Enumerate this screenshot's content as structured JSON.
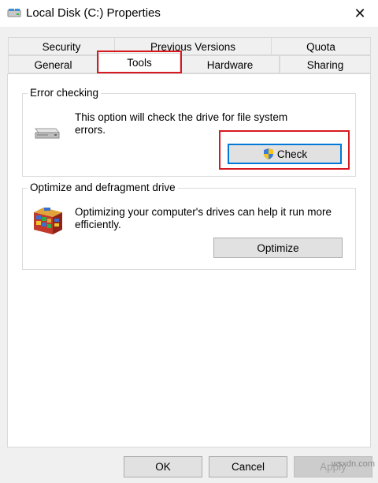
{
  "window": {
    "title": "Local Disk (C:) Properties",
    "close_glyph": "✕",
    "title_icon": "drive-icon"
  },
  "tabs": {
    "row_back": [
      {
        "label": "Security"
      },
      {
        "label": "Previous Versions"
      },
      {
        "label": "Quota"
      }
    ],
    "row_front": [
      {
        "label": "General"
      },
      {
        "label": "Tools",
        "selected": true
      },
      {
        "label": "Hardware"
      },
      {
        "label": "Sharing"
      }
    ]
  },
  "error_checking": {
    "title": "Error checking",
    "description": "This option will check the drive for file system errors.",
    "button_label": "Check",
    "icon": "drive-icon",
    "button_icon": "uac-shield-icon"
  },
  "optimize": {
    "title": "Optimize and defragment drive",
    "description": "Optimizing your computer's drives can help it run more efficiently.",
    "button_label": "Optimize",
    "icon": "defrag-icon"
  },
  "footer": {
    "ok_label": "OK",
    "cancel_label": "Cancel",
    "apply_label": "Apply"
  },
  "watermark": "wsxdn.com",
  "colors": {
    "highlight": "#d71920",
    "focus": "#0078d7"
  }
}
